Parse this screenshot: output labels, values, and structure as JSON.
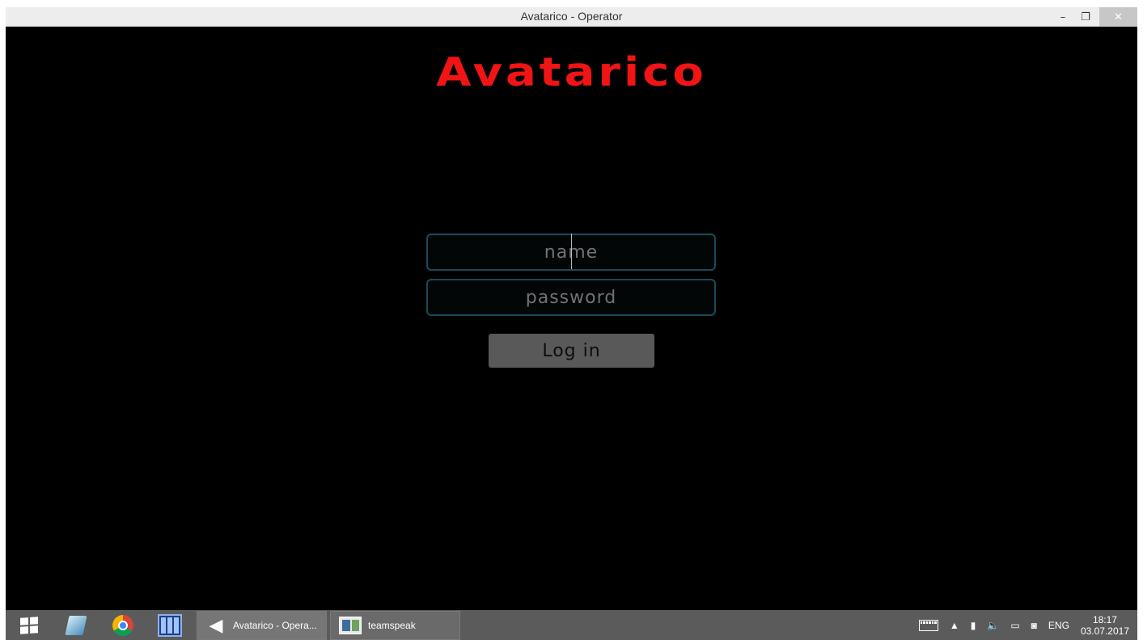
{
  "window": {
    "title": "Avatarico - Operator",
    "minimize_glyph": "–",
    "restore_glyph": "❐",
    "close_glyph": "✕"
  },
  "app": {
    "logo_text": "Avatarico",
    "name_field": {
      "placeholder": "name",
      "value": ""
    },
    "password_field": {
      "placeholder": "password",
      "value": ""
    },
    "login_label": "Log in",
    "colors": {
      "logo": "#f01414",
      "field_border": "#1d4a57",
      "button_bg": "#595959",
      "background": "#000000"
    }
  },
  "taskbar": {
    "start_icon": "windows-start-icon",
    "pinned": [
      {
        "name": "pen-app-icon"
      },
      {
        "name": "chrome-icon"
      },
      {
        "name": "server-app-icon"
      }
    ],
    "tasks": [
      {
        "label": "Avatarico - Opera...",
        "icon": "unity-icon"
      },
      {
        "label": "teamspeak",
        "icon": "teamspeak-icon"
      }
    ],
    "tray": {
      "language": "ENG",
      "time": "18:17",
      "date": "03.07.2017",
      "show_hidden_glyph": "▲"
    }
  }
}
